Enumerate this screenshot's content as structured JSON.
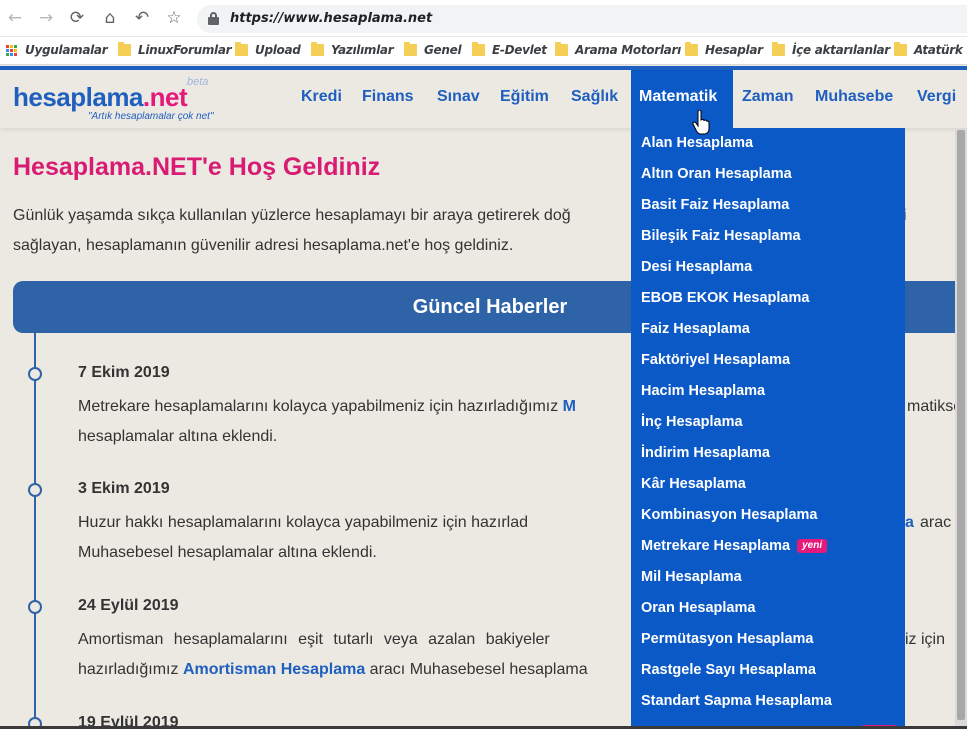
{
  "browser": {
    "url": "https://www.hesaplama.net",
    "bookmarks": [
      {
        "label": "Uygulamalar",
        "icon": "apps-grid-icon"
      },
      {
        "label": "LinuxForumlar",
        "icon": "folder-icon"
      },
      {
        "label": "Upload",
        "icon": "folder-icon"
      },
      {
        "label": "Yazılımlar",
        "icon": "folder-icon"
      },
      {
        "label": "Genel",
        "icon": "folder-icon"
      },
      {
        "label": "E-Devlet",
        "icon": "folder-icon"
      },
      {
        "label": "Arama Motorları",
        "icon": "folder-icon"
      },
      {
        "label": "Hesaplar",
        "icon": "folder-icon"
      },
      {
        "label": "İçe aktarılanlar",
        "icon": "folder-icon"
      },
      {
        "label": "Atatürk V",
        "icon": "folder-icon"
      }
    ]
  },
  "logo": {
    "part1": "hesaplama",
    "part2": ".net",
    "beta": "beta",
    "tagline": "\"Artık hesaplamalar çok net\""
  },
  "nav": {
    "items": [
      "Kredi",
      "Finans",
      "Sınav",
      "Eğitim",
      "Sağlık",
      "Matematik",
      "Zaman",
      "Muhasebe",
      "Vergi"
    ],
    "active": "Matematik"
  },
  "welcome": {
    "title": "Hesaplama.NET'e Hoş Geldiniz",
    "line1": "Günlük yaşamda sıkça kullanılan yüzlerce hesaplamayı bir araya getirerek doğ",
    "line1_tail": "i",
    "line2": "sağlayan, hesaplamanın güvenilir adresi hesaplama.net'e hoş geldiniz."
  },
  "news": {
    "title": "Güncel Haberler",
    "entries": [
      {
        "date": "7 Ekim 2019",
        "line1_a": "Metrekare hesaplamalarını kolayca yapabilmeniz için hazırladığımız ",
        "line1_link": "M",
        "line1_tail": "matikse",
        "line2": "hesaplamalar altına eklendi."
      },
      {
        "date": "3 Ekim 2019",
        "line1_a": "Huzur hakkı hesaplamalarını kolayca yapabilmeniz için hazırlad",
        "line1_tail_link": "a",
        "line1_tail": "arac",
        "line2": "Muhasebesel hesaplamalar altına eklendi."
      },
      {
        "date": "24 Eylül 2019",
        "line1_a": "Amortisman hesaplamalarını eşit tutarlı veya azalan bakiyeler",
        "line1_tail": "iz için",
        "line2_a": "hazırladığımız ",
        "line2_link": "Amortisman Hesaplama",
        "line2_b": " aracı Muhasebesel hesaplama"
      },
      {
        "date": "19 Eylül 2019"
      }
    ]
  },
  "dropdown": {
    "items": [
      "Alan Hesaplama",
      "Altın Oran Hesaplama",
      "Basit Faiz Hesaplama",
      "Bileşik Faiz Hesaplama",
      "Desi Hesaplama",
      "EBOB EKOK Hesaplama",
      "Faiz Hesaplama",
      "Faktöriyel Hesaplama",
      "Hacim Hesaplama",
      "İnç Hesaplama",
      "İndirim Hesaplama",
      "Kâr Hesaplama",
      "Kombinasyon Hesaplama",
      "Metrekare Hesaplama",
      "Mil Hesaplama",
      "Oran Hesaplama",
      "Permütasyon Hesaplama",
      "Rastgele Sayı Hesaplama",
      "Standart Sapma Hesaplama"
    ],
    "new_badge": "yeni",
    "new_item": "Metrekare Hesaplama"
  },
  "colors": {
    "brand_blue": "#1f5fbf",
    "brand_pink": "#e5197a",
    "menu_blue": "#0b59c6",
    "banner_blue": "#2f63a8",
    "page_bg": "#ece9e2"
  }
}
